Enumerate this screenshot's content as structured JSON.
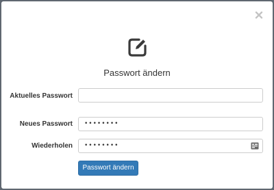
{
  "modal": {
    "title": "Passwort ändern",
    "close_icon": "close-icon",
    "header_icon": "edit-icon"
  },
  "form": {
    "current_password_label": "Aktuelles Passwort",
    "current_password_value": "",
    "new_password_label": "Neues Passwort",
    "new_password_value": "••••••••",
    "repeat_label": "Wiederholen",
    "repeat_value": "••••••••",
    "password_manager_icon": "password-manager-icon",
    "submit_label": "Passwort ändern"
  },
  "colors": {
    "primary": "#337ab7",
    "overlay": "#5f6770"
  }
}
